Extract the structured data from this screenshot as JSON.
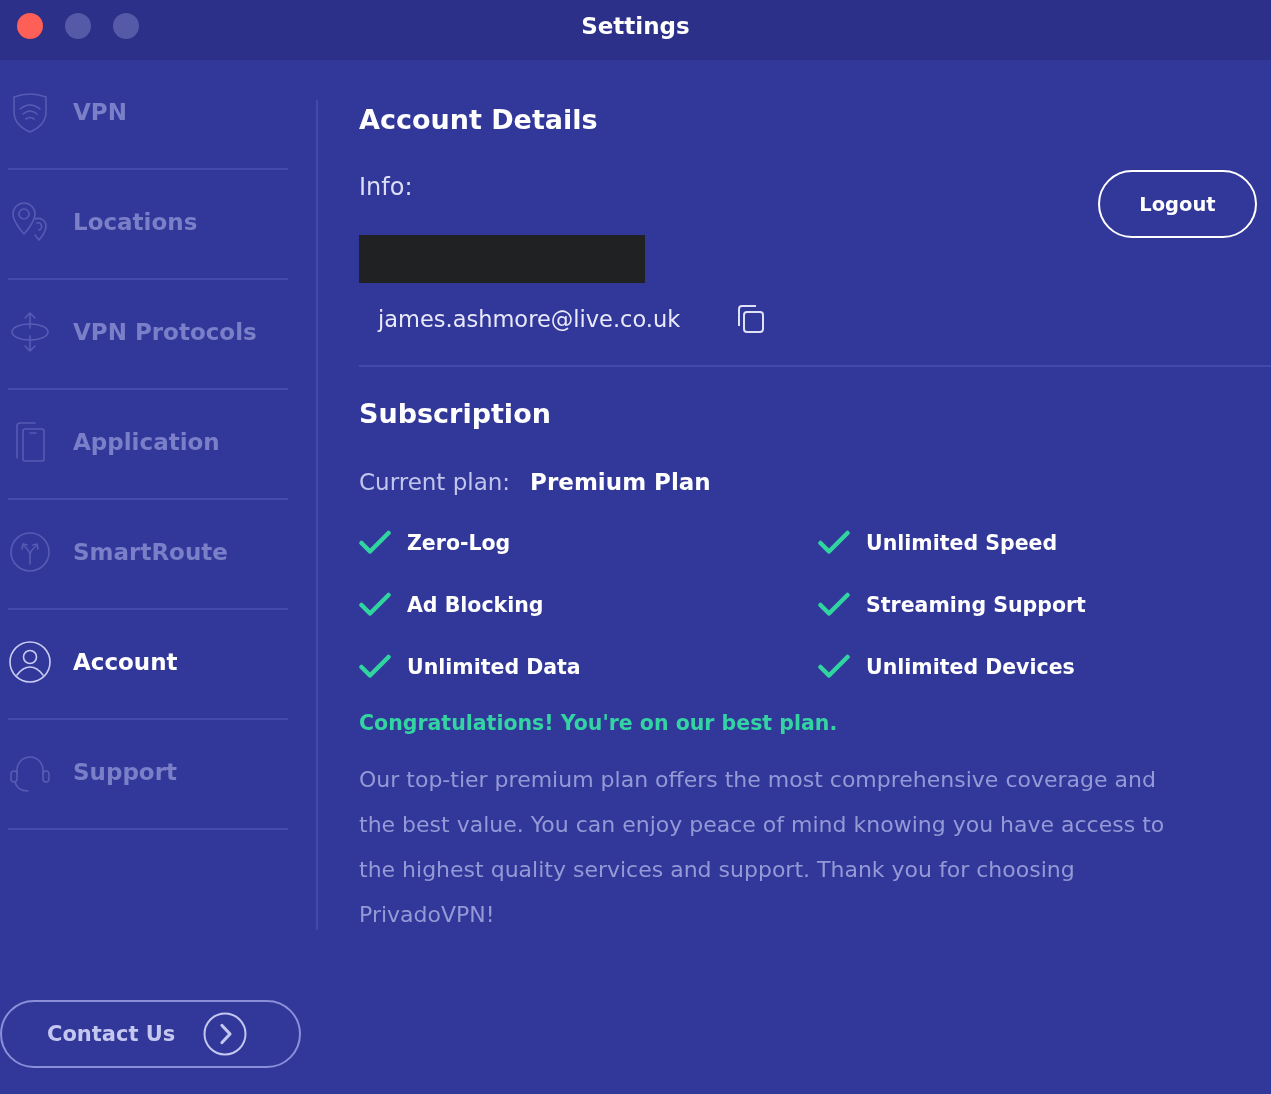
{
  "window": {
    "title": "Settings"
  },
  "sidebar": {
    "items": [
      {
        "label": "VPN",
        "selected": false
      },
      {
        "label": "Locations",
        "selected": false
      },
      {
        "label": "VPN Protocols",
        "selected": false
      },
      {
        "label": "Application",
        "selected": false
      },
      {
        "label": "SmartRoute",
        "selected": false
      },
      {
        "label": "Account",
        "selected": true
      },
      {
        "label": "Support",
        "selected": false
      }
    ],
    "contact_button": "Contact Us"
  },
  "account_details": {
    "heading": "Account Details",
    "info_label": "Info:",
    "email": "james.ashmore@live.co.uk",
    "logout_button": "Logout"
  },
  "subscription": {
    "heading": "Subscription",
    "plan_label": "Current plan:",
    "plan_name": "Premium Plan",
    "features": [
      {
        "label": "Zero-Log",
        "included": true
      },
      {
        "label": "Unlimited Speed",
        "included": true
      },
      {
        "label": "Ad Blocking",
        "included": true
      },
      {
        "label": "Streaming Support",
        "included": true
      },
      {
        "label": "Unlimited Data",
        "included": true
      },
      {
        "label": "Unlimited Devices",
        "included": true
      }
    ],
    "congrats": "Congratulations! You're on our best plan.",
    "description": "Our top-tier premium plan offers the most comprehensive coverage and the best value. You can enjoy peace of mind knowing you have access to the highest quality services and support. Thank you for choosing PrivadoVPN!"
  }
}
